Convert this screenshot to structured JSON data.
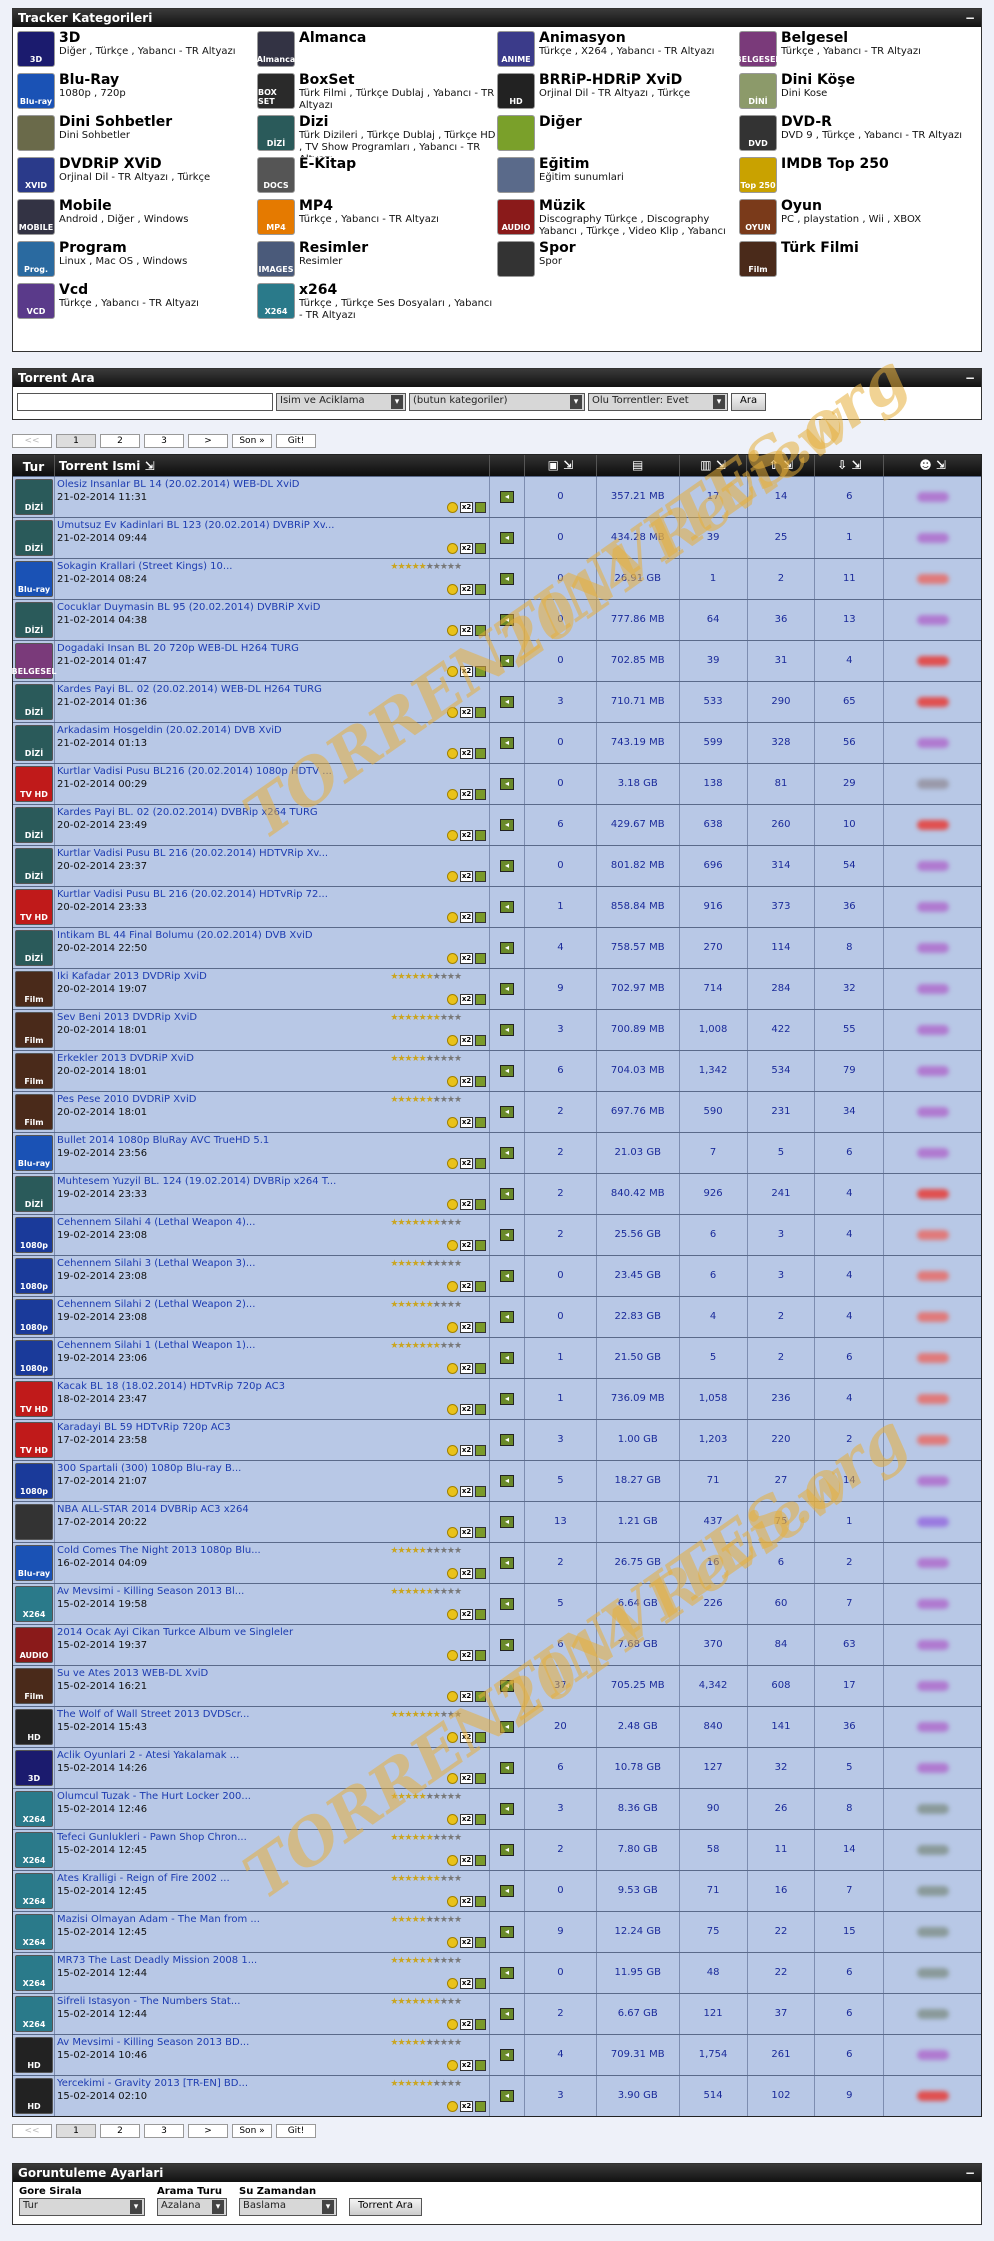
{
  "categories": {
    "title": "Tracker Kategorileri",
    "toggle": "−",
    "items": [
      {
        "name": "3D",
        "sub": "Diğer , Türkçe , Yabancı - TR Altyazı",
        "color": "#1b1b6e",
        "tag": "3D"
      },
      {
        "name": "Almanca",
        "sub": "",
        "color": "#334",
        "tag": "Almanca"
      },
      {
        "name": "Animasyon",
        "sub": "Türkçe , X264 , Yabancı - TR Altyazı",
        "color": "#3b3b8a",
        "tag": "ANIME"
      },
      {
        "name": "Belgesel",
        "sub": "Türkçe , Yabancı - TR Altyazı",
        "color": "#7a3a7a",
        "tag": "BELGESEL"
      },
      {
        "name": "Blu-Ray",
        "sub": "1080p , 720p",
        "color": "#1a52b5",
        "tag": "Blu-ray"
      },
      {
        "name": "BoxSet",
        "sub": "Türk Filmi , Türkçe Dublaj , Yabancı - TR Altyazı",
        "color": "#2a2a2a",
        "tag": "BOX SET"
      },
      {
        "name": "BRRiP-HDRiP XviD",
        "sub": "Orjinal Dil - TR Altyazı , Türkçe",
        "color": "#222",
        "tag": "HD"
      },
      {
        "name": "Dini Köşe",
        "sub": "Dini Kose",
        "color": "#8c9a6a",
        "tag": "DİNİ"
      },
      {
        "name": "Dini Sohbetler",
        "sub": "Dini Sohbetler",
        "color": "#6a6a4a",
        "tag": ""
      },
      {
        "name": "Dizi",
        "sub": "Türk Dizileri , Türkçe Dublaj , Türkçe HD , TV Show Programları , Yabancı - TR Altyazı",
        "color": "#2a5a5a",
        "tag": "DİZİ"
      },
      {
        "name": "Diğer",
        "sub": "",
        "color": "#7aa02a",
        "tag": ""
      },
      {
        "name": "DVD-R",
        "sub": "DVD 9 , Türkçe , Yabancı - TR Altyazı",
        "color": "#333",
        "tag": "DVD"
      },
      {
        "name": "DVDRiP XViD",
        "sub": "Orjinal Dil - TR Altyazı , Türkçe",
        "color": "#2a3a8a",
        "tag": "XVID"
      },
      {
        "name": "E-Kitap",
        "sub": "",
        "color": "#555",
        "tag": "DOCS"
      },
      {
        "name": "Eğitim",
        "sub": "Eğitim sunumlari",
        "color": "#5a6a8a",
        "tag": ""
      },
      {
        "name": "IMDB Top 250",
        "sub": "",
        "color": "#c9a200",
        "tag": "Top 250"
      },
      {
        "name": "Mobile",
        "sub": "Android , Diğer , Windows",
        "color": "#334",
        "tag": "MOBILE"
      },
      {
        "name": "MP4",
        "sub": "Türkçe , Yabancı - TR Altyazı",
        "color": "#e57a00",
        "tag": "MP4"
      },
      {
        "name": "Müzik",
        "sub": "Discography Türkçe , Discography Yabancı , Türkçe , Video Klip , Yabancı",
        "color": "#8a1a1a",
        "tag": "AUDIO"
      },
      {
        "name": "Oyun",
        "sub": "PC , playstation , Wii , XBOX",
        "color": "#7a3a1a",
        "tag": "OYUN"
      },
      {
        "name": "Program",
        "sub": "Linux , Mac OS , Windows",
        "color": "#2a6aa0",
        "tag": "Prog."
      },
      {
        "name": "Resimler",
        "sub": "Resimler",
        "color": "#4a5a7a",
        "tag": "IMAGES"
      },
      {
        "name": "Spor",
        "sub": "Spor",
        "color": "#333",
        "tag": ""
      },
      {
        "name": "Türk Filmi",
        "sub": "",
        "color": "#4a2a1a",
        "tag": "Film"
      },
      {
        "name": "Vcd",
        "sub": "Türkçe , Yabancı - TR Altyazı",
        "color": "#5a3a8a",
        "tag": "VCD"
      },
      {
        "name": "x264",
        "sub": "Türkçe , Türkçe Ses Dosyaları , Yabancı - TR Altyazı",
        "color": "#2a7a8a",
        "tag": "X264"
      }
    ]
  },
  "search": {
    "title": "Torrent Ara",
    "toggle": "−",
    "placeholder": "",
    "field": "Isim ve Aciklama",
    "category": "(butun kategoriler)",
    "alive": "Olu Torrentler: Evet",
    "button": "Ara"
  },
  "pager": {
    "prev": "<<",
    "pages": [
      "1",
      "2",
      "3"
    ],
    "next": ">",
    "last": "Son »",
    "go": "Git!"
  },
  "table": {
    "headers": {
      "tur": "Tur",
      "name": "Torrent Ismi"
    },
    "rows": [
      {
        "t": "DİZİ",
        "c": "#2a5a5a",
        "n": "Olesiz Insanlar BL 14 (20.02.2014) WEB-DL XviD",
        "d": "21-02-2014 11:31",
        "st": "",
        "cm": "0",
        "sz": "357.21 MB",
        "sn": "17",
        "se": "14",
        "le": "6",
        "b": "#b07ad0"
      },
      {
        "t": "DİZİ",
        "c": "#2a5a5a",
        "n": "Umutsuz Ev Kadinlari BL 123 (20.02.2014) DVBRiP Xv...",
        "d": "21-02-2014 09:44",
        "st": "",
        "cm": "0",
        "sz": "434.28 MB",
        "sn": "39",
        "se": "25",
        "le": "1",
        "b": "#b07ad0"
      },
      {
        "t": "Blu-ray",
        "c": "#1a52b5",
        "n": "Sokagin Krallari (Street Kings) 10...",
        "d": "21-02-2014 08:24",
        "st": "★★★★★★★★★★",
        "cm": "0",
        "sz": "26.91 GB",
        "sn": "1",
        "se": "2",
        "le": "11",
        "b": "#e07a7a"
      },
      {
        "t": "DİZİ",
        "c": "#2a5a5a",
        "n": "Cocuklar Duymasin BL 95 (20.02.2014) DVBRiP XviD",
        "d": "21-02-2014 04:38",
        "st": "",
        "cm": "0",
        "sz": "777.86 MB",
        "sn": "64",
        "se": "36",
        "le": "13",
        "b": "#b07ad0"
      },
      {
        "t": "BELGESEL",
        "c": "#7a3a7a",
        "n": "Dogadaki Insan BL 20 720p WEB-DL H264 TURG",
        "d": "21-02-2014 01:47",
        "st": "",
        "cm": "0",
        "sz": "702.85 MB",
        "sn": "39",
        "se": "31",
        "le": "4",
        "b": "#e05050"
      },
      {
        "t": "DİZİ",
        "c": "#2a5a5a",
        "n": "Kardes Payi BL. 02 (20.02.2014) WEB-DL H264 TURG",
        "d": "21-02-2014 01:36",
        "st": "",
        "cm": "3",
        "sz": "710.71 MB",
        "sn": "533",
        "se": "290",
        "le": "65",
        "b": "#e05050"
      },
      {
        "t": "DİZİ",
        "c": "#2a5a5a",
        "n": "Arkadasim Hosgeldin (20.02.2014) DVB XviD",
        "d": "21-02-2014 01:13",
        "st": "",
        "cm": "0",
        "sz": "743.19 MB",
        "sn": "599",
        "se": "328",
        "le": "56",
        "b": "#b07ad0"
      },
      {
        "t": "TV HD",
        "c": "#c01a1a",
        "n": "Kurtlar Vadisi Pusu BL216 (20.02.2014) 1080p HDTV ...",
        "d": "21-02-2014 00:29",
        "st": "",
        "cm": "0",
        "sz": "3.18 GB",
        "sn": "138",
        "se": "81",
        "le": "29",
        "b": "#9a9aaa"
      },
      {
        "t": "DİZİ",
        "c": "#2a5a5a",
        "n": "Kardes Payi BL. 02 (20.02.2014) DVBRip x264 TURG",
        "d": "20-02-2014 23:49",
        "st": "",
        "cm": "6",
        "sz": "429.67 MB",
        "sn": "638",
        "se": "260",
        "le": "10",
        "b": "#e05050"
      },
      {
        "t": "DİZİ",
        "c": "#2a5a5a",
        "n": "Kurtlar Vadisi Pusu BL 216 (20.02.2014) HDTVRip Xv...",
        "d": "20-02-2014 23:37",
        "st": "",
        "cm": "0",
        "sz": "801.82 MB",
        "sn": "696",
        "se": "314",
        "le": "54",
        "b": "#b07ad0"
      },
      {
        "t": "TV HD",
        "c": "#c01a1a",
        "n": "Kurtlar Vadisi Pusu BL 216 (20.02.2014) HDTvRip 72...",
        "d": "20-02-2014 23:33",
        "st": "",
        "cm": "1",
        "sz": "858.84 MB",
        "sn": "916",
        "se": "373",
        "le": "36",
        "b": "#b07ad0"
      },
      {
        "t": "DİZİ",
        "c": "#2a5a5a",
        "n": "Intikam BL 44 Final Bolumu (20.02.2014) DVB XviD",
        "d": "20-02-2014 22:50",
        "st": "",
        "cm": "4",
        "sz": "758.57 MB",
        "sn": "270",
        "se": "114",
        "le": "8",
        "b": "#b07ad0"
      },
      {
        "t": "Film",
        "c": "#4a2a1a",
        "n": "Iki Kafadar 2013 DVDRip XviD",
        "d": "20-02-2014 19:07",
        "st": "★★★★★★★★★★",
        "cm": "9",
        "sz": "702.97 MB",
        "sn": "714",
        "se": "284",
        "le": "32",
        "b": "#b07ad0"
      },
      {
        "t": "Film",
        "c": "#4a2a1a",
        "n": "Sev Beni 2013 DVDRip XviD",
        "d": "20-02-2014 18:01",
        "st": "★★★★★★★★★★",
        "cm": "3",
        "sz": "700.89 MB",
        "sn": "1,008",
        "se": "422",
        "le": "55",
        "b": "#b07ad0"
      },
      {
        "t": "Film",
        "c": "#4a2a1a",
        "n": "Erkekler 2013 DVDRiP XviD",
        "d": "20-02-2014 18:01",
        "st": "★★★★★★★★★★",
        "cm": "6",
        "sz": "704.03 MB",
        "sn": "1,342",
        "se": "534",
        "le": "79",
        "b": "#b07ad0"
      },
      {
        "t": "Film",
        "c": "#4a2a1a",
        "n": "Pes Pese 2010 DVDRiP XviD",
        "d": "20-02-2014 18:01",
        "st": "★★★★★★★★★★",
        "cm": "2",
        "sz": "697.76 MB",
        "sn": "590",
        "se": "231",
        "le": "34",
        "b": "#b07ad0"
      },
      {
        "t": "Blu-ray",
        "c": "#1a52b5",
        "n": "Bullet 2014 1080p BluRay AVC TrueHD 5.1",
        "d": "19-02-2014 23:56",
        "st": "",
        "cm": "2",
        "sz": "21.03 GB",
        "sn": "7",
        "se": "5",
        "le": "6",
        "b": "#b07ad0"
      },
      {
        "t": "DİZİ",
        "c": "#2a5a5a",
        "n": "Muhtesem Yuzyil BL. 124 (19.02.2014) DVBRip x264 T...",
        "d": "19-02-2014 23:33",
        "st": "",
        "cm": "2",
        "sz": "840.42 MB",
        "sn": "926",
        "se": "241",
        "le": "4",
        "b": "#e05050"
      },
      {
        "t": "1080p",
        "c": "#1a3a9a",
        "n": "Cehennem Silahi 4 (Lethal Weapon 4)...",
        "d": "19-02-2014 23:08",
        "st": "★★★★★★★★★★",
        "cm": "2",
        "sz": "25.56 GB",
        "sn": "6",
        "se": "3",
        "le": "4",
        "b": "#e07a7a"
      },
      {
        "t": "1080p",
        "c": "#1a3a9a",
        "n": "Cehennem Silahi 3 (Lethal Weapon 3)...",
        "d": "19-02-2014 23:08",
        "st": "★★★★★★★★★★",
        "cm": "0",
        "sz": "23.45 GB",
        "sn": "6",
        "se": "3",
        "le": "4",
        "b": "#e07a7a"
      },
      {
        "t": "1080p",
        "c": "#1a3a9a",
        "n": "Cehennem Silahi 2 (Lethal Weapon 2)...",
        "d": "19-02-2014 23:08",
        "st": "★★★★★★★★★★",
        "cm": "0",
        "sz": "22.83 GB",
        "sn": "4",
        "se": "2",
        "le": "4",
        "b": "#e07a7a"
      },
      {
        "t": "1080p",
        "c": "#1a3a9a",
        "n": "Cehennem Silahi 1 (Lethal Weapon 1)...",
        "d": "19-02-2014 23:06",
        "st": "★★★★★★★★★★",
        "cm": "1",
        "sz": "21.50 GB",
        "sn": "5",
        "se": "2",
        "le": "6",
        "b": "#e07a7a"
      },
      {
        "t": "TV HD",
        "c": "#c01a1a",
        "n": "Kacak BL 18 (18.02.2014) HDTvRip 720p AC3",
        "d": "18-02-2014 23:47",
        "st": "",
        "cm": "1",
        "sz": "736.09 MB",
        "sn": "1,058",
        "se": "236",
        "le": "4",
        "b": "#e07a7a"
      },
      {
        "t": "TV HD",
        "c": "#c01a1a",
        "n": "Karadayi BL 59 HDTvRip 720p AC3",
        "d": "17-02-2014 23:58",
        "st": "",
        "cm": "3",
        "sz": "1.00 GB",
        "sn": "1,203",
        "se": "220",
        "le": "2",
        "b": "#e07a7a"
      },
      {
        "t": "1080p",
        "c": "#1a3a9a",
        "n": "300 Spartali (300) 1080p Blu-ray B...",
        "d": "17-02-2014 21:07",
        "st": "",
        "cm": "5",
        "sz": "18.27 GB",
        "sn": "71",
        "se": "27",
        "le": "14",
        "b": "#b07ad0"
      },
      {
        "t": "",
        "c": "#333",
        "n": "NBA ALL-STAR 2014 DVBRip AC3 x264",
        "d": "17-02-2014 20:22",
        "st": "",
        "cm": "13",
        "sz": "1.21 GB",
        "sn": "437",
        "se": "75",
        "le": "1",
        "b": "#9a7ae0"
      },
      {
        "t": "Blu-ray",
        "c": "#1a52b5",
        "n": "Cold Comes The Night 2013 1080p Blu...",
        "d": "16-02-2014 04:09",
        "st": "★★★★★★★★★★",
        "cm": "2",
        "sz": "26.75 GB",
        "sn": "16",
        "se": "6",
        "le": "2",
        "b": "#b07ad0"
      },
      {
        "t": "X264",
        "c": "#2a7a8a",
        "n": "Av Mevsimi - Killing Season 2013 Bl...",
        "d": "15-02-2014 19:58",
        "st": "★★★★★★★★★★",
        "cm": "5",
        "sz": "6.64 GB",
        "sn": "226",
        "se": "60",
        "le": "7",
        "b": "#b07ad0"
      },
      {
        "t": "AUDIO",
        "c": "#8a1a1a",
        "n": "2014 Ocak Ayi Cikan Turkce Album ve Singleler",
        "d": "15-02-2014 19:37",
        "st": "",
        "cm": "6",
        "sz": "7.68 GB",
        "sn": "370",
        "se": "84",
        "le": "63",
        "b": "#b07ad0"
      },
      {
        "t": "Film",
        "c": "#4a2a1a",
        "n": "Su ve Ates 2013 WEB-DL XviD",
        "d": "15-02-2014 16:21",
        "st": "",
        "cm": "37",
        "sz": "705.25 MB",
        "sn": "4,342",
        "se": "608",
        "le": "17",
        "b": "#b07ad0"
      },
      {
        "t": "HD",
        "c": "#222",
        "n": "The Wolf of Wall Street 2013 DVDScr...",
        "d": "15-02-2014 15:43",
        "st": "★★★★★★★★★★",
        "cm": "20",
        "sz": "2.48 GB",
        "sn": "840",
        "se": "141",
        "le": "36",
        "b": "#b07ad0"
      },
      {
        "t": "3D",
        "c": "#1b1b6e",
        "n": "Aclik Oyunlari 2 - Atesi Yakalamak ...",
        "d": "15-02-2014 14:26",
        "st": "",
        "cm": "6",
        "sz": "10.78 GB",
        "sn": "127",
        "se": "32",
        "le": "5",
        "b": "#b07ad0"
      },
      {
        "t": "X264",
        "c": "#2a7a8a",
        "n": "Olumcul Tuzak - The Hurt Locker 200...",
        "d": "15-02-2014 12:46",
        "st": "★★★★★★★★★★",
        "cm": "3",
        "sz": "8.36 GB",
        "sn": "90",
        "se": "26",
        "le": "8",
        "b": "#8a9a9a"
      },
      {
        "t": "X264",
        "c": "#2a7a8a",
        "n": "Tefeci Gunlukleri - Pawn Shop Chron...",
        "d": "15-02-2014 12:45",
        "st": "★★★★★★★★★★",
        "cm": "2",
        "sz": "7.80 GB",
        "sn": "58",
        "se": "11",
        "le": "14",
        "b": "#8a9a9a"
      },
      {
        "t": "X264",
        "c": "#2a7a8a",
        "n": "Ates Kralligi - Reign of Fire 2002 ...",
        "d": "15-02-2014 12:45",
        "st": "★★★★★★★★★★",
        "cm": "0",
        "sz": "9.53 GB",
        "sn": "71",
        "se": "16",
        "le": "7",
        "b": "#8a9a9a"
      },
      {
        "t": "X264",
        "c": "#2a7a8a",
        "n": "Mazisi Olmayan Adam - The Man from ...",
        "d": "15-02-2014 12:45",
        "st": "★★★★★★★★★★",
        "cm": "9",
        "sz": "12.24 GB",
        "sn": "75",
        "se": "22",
        "le": "15",
        "b": "#8a9a9a"
      },
      {
        "t": "X264",
        "c": "#2a7a8a",
        "n": "MR73 The Last Deadly Mission 2008 1...",
        "d": "15-02-2014 12:44",
        "st": "★★★★★★★★★★",
        "cm": "0",
        "sz": "11.95 GB",
        "sn": "48",
        "se": "22",
        "le": "6",
        "b": "#8a9a9a"
      },
      {
        "t": "X264",
        "c": "#2a7a8a",
        "n": "Sifreli Istasyon - The Numbers Stat...",
        "d": "15-02-2014 12:44",
        "st": "★★★★★★★★★★",
        "cm": "2",
        "sz": "6.67 GB",
        "sn": "121",
        "se": "37",
        "le": "6",
        "b": "#8a9a9a"
      },
      {
        "t": "HD",
        "c": "#222",
        "n": "Av Mevsimi - Killing Season 2013 BD...",
        "d": "15-02-2014 10:46",
        "st": "★★★★★★★★★★",
        "cm": "4",
        "sz": "709.31 MB",
        "sn": "1,754",
        "se": "261",
        "le": "6",
        "b": "#b07ad0"
      },
      {
        "t": "HD",
        "c": "#222",
        "n": "Yercekimi - Gravity 2013 [TR-EN] BD...",
        "d": "15-02-2014 02:10",
        "st": "★★★★★★★★★★",
        "cm": "3",
        "sz": "3.90 GB",
        "sn": "514",
        "se": "102",
        "le": "9",
        "b": "#e05050"
      }
    ]
  },
  "options": {
    "title": "Goruntuleme Ayarlari",
    "toggle": "−",
    "sort_label": "Gore Sirala",
    "sort_value": "Tur",
    "order_label": "Arama Turu",
    "order_value": "Azalana",
    "time_label": "Su Zamandan",
    "time_value": "Baslama",
    "button": "Torrent Ara"
  },
  "watermark": {
    "line1": "TORRENTINVITES.org",
    "line2": "2014 Review"
  }
}
